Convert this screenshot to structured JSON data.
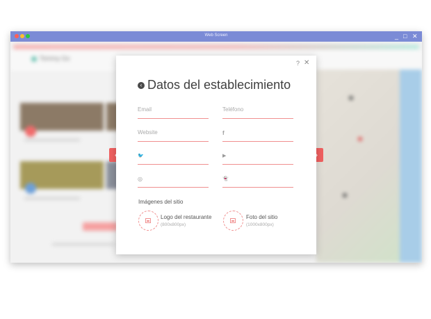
{
  "window": {
    "title": "Web Screen",
    "minimize": "_",
    "maximize": "□",
    "close": "✕"
  },
  "background": {
    "brand": "Tommy Go"
  },
  "modal": {
    "help": "?",
    "close": "✕",
    "title": "Datos del establecimiento",
    "fields": {
      "email": {
        "placeholder": "Email"
      },
      "telefono": {
        "placeholder": "Teléfono"
      },
      "website": {
        "placeholder": "Website"
      },
      "facebook": {
        "icon": "facebook-icon",
        "glyph": "f"
      },
      "twitter": {
        "icon": "twitter-icon",
        "glyph": "🐦"
      },
      "youtube": {
        "icon": "youtube-icon",
        "glyph": "▶"
      },
      "instagram": {
        "icon": "instagram-icon",
        "glyph": "◎"
      },
      "snapchat": {
        "icon": "snapchat-icon",
        "glyph": "👻"
      }
    },
    "images": {
      "section_label": "Imágenes del sitio",
      "logo": {
        "label": "Logo del restaurante",
        "dims": "(800x800px)"
      },
      "photo": {
        "label": "Foto del sitio",
        "dims": "(1000x800px)"
      }
    }
  },
  "nav": {
    "prev": "‹",
    "next": "›"
  },
  "colors": {
    "accent": "#f06060",
    "titlebar": "#7b8bd6",
    "field_line": "#f08f8f"
  }
}
